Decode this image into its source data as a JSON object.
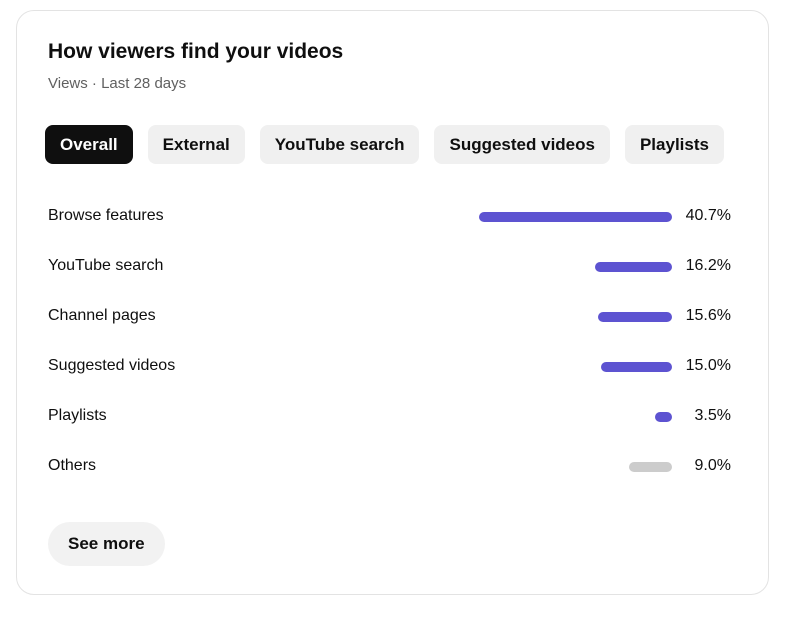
{
  "card": {
    "title": "How viewers find your videos",
    "subtitle": "Views · Last 28 days"
  },
  "tabs": [
    {
      "label": "Overall",
      "active": true
    },
    {
      "label": "External",
      "active": false
    },
    {
      "label": "YouTube search",
      "active": false
    },
    {
      "label": "Suggested videos",
      "active": false
    },
    {
      "label": "Playlists",
      "active": false
    }
  ],
  "sources": [
    {
      "label": "Browse features",
      "value_text": "40.7%",
      "percent": 40.7
    },
    {
      "label": "YouTube search",
      "value_text": "16.2%",
      "percent": 16.2
    },
    {
      "label": "Channel pages",
      "value_text": "15.6%",
      "percent": 15.6
    },
    {
      "label": "Suggested videos",
      "value_text": "15.0%",
      "percent": 15.0
    },
    {
      "label": "Playlists",
      "value_text": "3.5%",
      "percent": 3.5
    },
    {
      "label": "Others",
      "value_text": "9.0%",
      "percent": 9.0
    }
  ],
  "see_more_label": "See more",
  "colors": {
    "bar": "#5d53d1",
    "bar_others": "#cccccc",
    "active_tab_bg": "#0f0f0f",
    "tab_bg": "#f0f0f0"
  }
}
